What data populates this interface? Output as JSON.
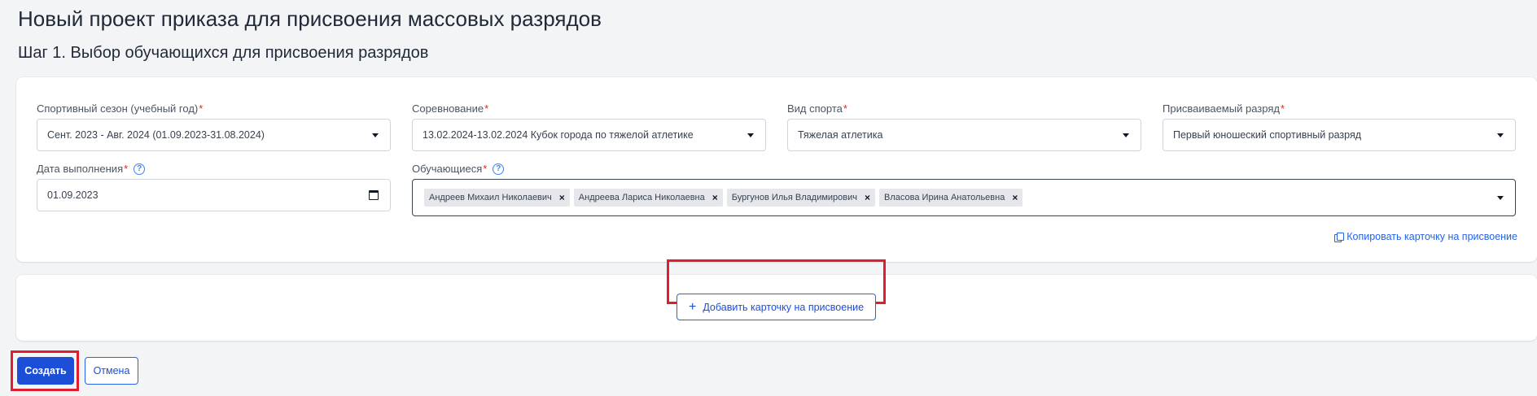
{
  "page": {
    "title": "Новый проект приказа для присвоения массовых разрядов",
    "step_title": "Шаг 1. Выбор обучающихся для присвоения разрядов"
  },
  "form": {
    "season": {
      "label": "Спортивный сезон (учебный год)",
      "required_mark": "*",
      "value": "Сент. 2023 - Авг. 2024 (01.09.2023-31.08.2024)"
    },
    "competition": {
      "label": "Соревнование",
      "required_mark": "*",
      "value": "13.02.2024-13.02.2024 Кубок города по тяжелой атлетике"
    },
    "sport": {
      "label": "Вид спорта",
      "required_mark": "*",
      "value": "Тяжелая атлетика"
    },
    "rank": {
      "label": "Присваиваемый разряд",
      "required_mark": "*",
      "value": "Первый юношеский спортивный разряд"
    },
    "completion_date": {
      "label": "Дата выполнения",
      "required_mark": "*",
      "help": "?",
      "value": "01.09.2023"
    },
    "students": {
      "label": "Обучающиеся",
      "required_mark": "*",
      "help": "?",
      "chips": [
        "Андреев Михаил Николаевич",
        "Андреева Лариса Николаевна",
        "Бургунов Илья Владимирович",
        "Власова Ирина Анатольевна"
      ],
      "remove_glyph": "×"
    },
    "copy_card_link": "Копировать карточку на присвоение"
  },
  "add_card": {
    "icon": "+",
    "label": "Добавить карточку на присвоение"
  },
  "actions": {
    "create_label": "Создать",
    "cancel_label": "Отмена"
  },
  "colors": {
    "accent": "#1d4ed8",
    "link": "#2563eb",
    "required": "#dc2626",
    "highlight": "#e11d2e",
    "background": "#f3f4f6"
  }
}
